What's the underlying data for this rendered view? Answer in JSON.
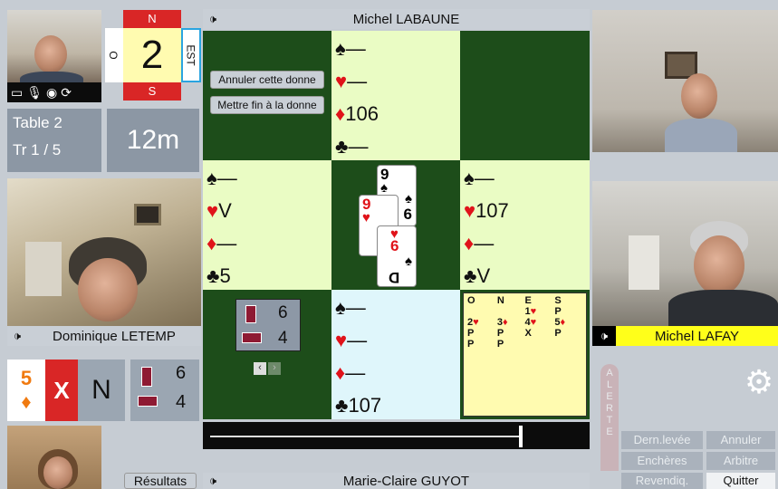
{
  "compass": {
    "north": "N",
    "south": "S",
    "west": "O",
    "east": "EST",
    "deal_number": "2"
  },
  "table_info": {
    "table": "Table 2",
    "round": "Tr 1 / 5",
    "timer": "12m"
  },
  "players": {
    "north": "Michel LABAUNE",
    "west": "Dominique LETEMP",
    "east": "Michel LAFAY",
    "south": "Marie-Claire GUYOT"
  },
  "buttons": {
    "cancel_deal": "Annuler cette donne",
    "end_deal": "Mettre fin à la donne",
    "results": "Résultats",
    "last_trick": "Dern.levée",
    "cancel": "Annuler",
    "bids": "Enchères",
    "referee": "Arbitre",
    "claim": "Revendiq.",
    "quit": "Quitter",
    "alert": "ALERTE"
  },
  "north_hand": {
    "spades": "—",
    "hearts": "—",
    "diamonds": "106",
    "clubs": "—"
  },
  "west_hand": {
    "spades": "—",
    "hearts": "V",
    "diamonds": "—",
    "clubs": "5"
  },
  "east_hand": {
    "spades": "—",
    "hearts": "107",
    "diamonds": "—",
    "clubs": "V"
  },
  "south_hand": {
    "spades": "—",
    "hearts": "—",
    "diamonds": "—",
    "clubs": "107"
  },
  "trick_cards": [
    {
      "rank": "9",
      "suit": "♠",
      "bottom": "6"
    },
    {
      "rank": "9",
      "suit": "♥",
      "bottom": ""
    },
    {
      "rank": "6",
      "suit": "♥",
      "bottom": "D"
    }
  ],
  "tricks": {
    "ns": "6",
    "ew": "4"
  },
  "contract": {
    "level": "5",
    "suit": "♦",
    "double": "X",
    "declarer": "N",
    "ns_tricks": "6",
    "ew_tricks": "4"
  },
  "bidding": {
    "headers": [
      "O",
      "N",
      "E",
      "S"
    ],
    "rows": [
      [
        "",
        "",
        "1♥",
        "P"
      ],
      [
        "2♥",
        "3♦",
        "4♥",
        "5♦"
      ],
      [
        "P",
        "P",
        "X",
        "P"
      ],
      [
        "P",
        "P",
        "",
        ""
      ]
    ]
  },
  "slider": {
    "value": 1.0
  },
  "nav": {
    "prev": "‹",
    "next": "›"
  },
  "icons": {
    "camera": "camera-icon",
    "mic": "mic-icon",
    "eye": "eye-icon",
    "refresh": "refresh-icon",
    "gear": "gear-icon",
    "speaker": "speaker-icon"
  },
  "speaker_glyph": "🕩"
}
